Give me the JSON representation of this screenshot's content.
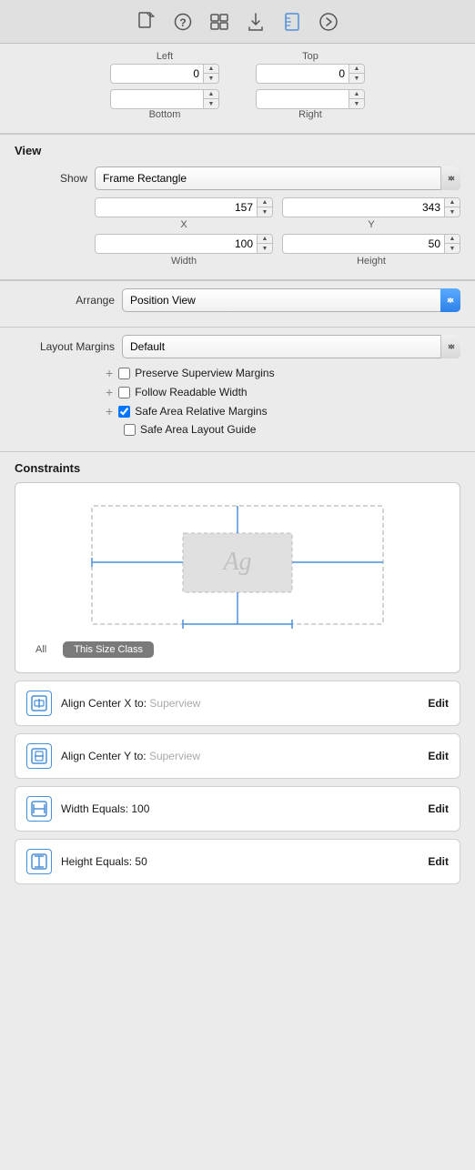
{
  "toolbar": {
    "icons": [
      {
        "name": "file-icon",
        "glyph": "📄",
        "active": false
      },
      {
        "name": "help-icon",
        "glyph": "?",
        "active": false
      },
      {
        "name": "grid-icon",
        "glyph": "▦",
        "active": false
      },
      {
        "name": "download-icon",
        "glyph": "↓",
        "active": false
      },
      {
        "name": "ruler-icon",
        "glyph": "📏",
        "active": true
      },
      {
        "name": "forward-icon",
        "glyph": "⊕",
        "active": false
      }
    ]
  },
  "inset": {
    "left_label": "Left",
    "top_label": "Top",
    "bottom_label": "Bottom",
    "right_label": "Right",
    "left_value": "0",
    "top_value": "0",
    "bottom_value": "",
    "right_value": ""
  },
  "view": {
    "title": "View",
    "show_label": "Show",
    "show_value": "Frame Rectangle",
    "x_value": "157",
    "y_value": "343",
    "x_label": "X",
    "y_label": "Y",
    "width_value": "100",
    "height_value": "50",
    "width_label": "Width",
    "height_label": "Height"
  },
  "arrange": {
    "label": "Arrange",
    "value": "Position View"
  },
  "layout_margins": {
    "label": "Layout Margins",
    "value": "Default",
    "checkboxes": [
      {
        "id": "preserve",
        "label": "Preserve Superview Margins",
        "checked": false,
        "has_plus": true
      },
      {
        "id": "readable",
        "label": "Follow Readable Width",
        "checked": false,
        "has_plus": true
      },
      {
        "id": "safe_area",
        "label": "Safe Area Relative Margins",
        "checked": true,
        "has_plus": true
      },
      {
        "id": "layout_guide",
        "label": "Safe Area Layout Guide",
        "checked": false,
        "has_plus": false
      }
    ]
  },
  "constraints": {
    "title": "Constraints",
    "tabs": [
      {
        "label": "All",
        "active": false
      },
      {
        "label": "This Size Class",
        "active": true
      }
    ],
    "items": [
      {
        "icon_type": "align-center-x",
        "text_before": "Align Center X to: ",
        "text_muted": "Superview",
        "edit_label": "Edit"
      },
      {
        "icon_type": "align-center-y",
        "text_before": "Align Center Y to: ",
        "text_muted": "Superview",
        "edit_label": "Edit"
      },
      {
        "icon_type": "width-equals",
        "text_before": "Width Equals: ",
        "text_value": "100",
        "edit_label": "Edit"
      },
      {
        "icon_type": "height-equals",
        "text_before": "Height Equals: ",
        "text_value": "50",
        "edit_label": "Edit"
      }
    ]
  }
}
